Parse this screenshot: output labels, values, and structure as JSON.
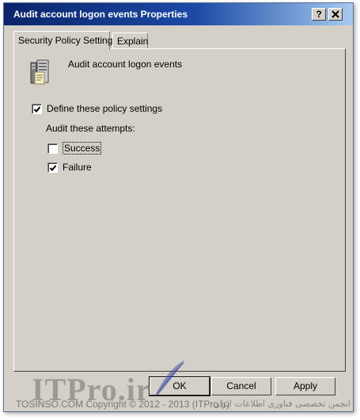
{
  "window": {
    "title": "Audit account logon events Properties"
  },
  "titlebar_buttons": {
    "help": "?",
    "close": "X"
  },
  "tabs": [
    {
      "label": "Security Policy Setting",
      "active": true
    },
    {
      "label": "Explain",
      "active": false
    }
  ],
  "policy": {
    "icon": "policy-server-icon",
    "name": "Audit account logon events"
  },
  "define": {
    "label": "Define these policy settings",
    "checked": true
  },
  "attempts": {
    "label": "Audit these attempts:",
    "success": {
      "label": "Success",
      "checked": false
    },
    "failure": {
      "label": "Failure",
      "checked": true
    }
  },
  "buttons": {
    "ok": "OK",
    "cancel": "Cancel",
    "apply": "Apply"
  },
  "watermark": {
    "logo": "ITPro.ir",
    "copyright": "TOSINSO.COM   Copyright © 2012 - 2013 (ITPro.ir)",
    "persian": "انجمن تخصصی فناوری اطلاعات ایران"
  }
}
